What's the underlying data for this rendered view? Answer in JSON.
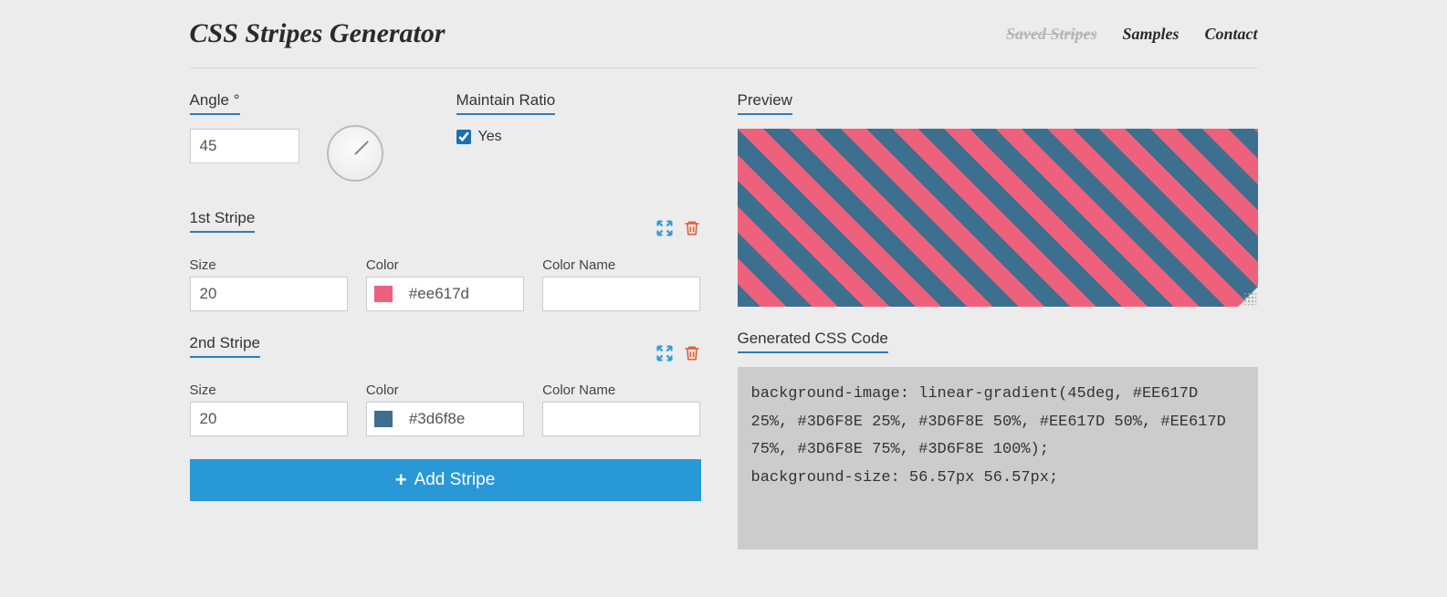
{
  "header": {
    "title": "CSS Stripes Generator",
    "nav": {
      "saved": "Saved Stripes",
      "samples": "Samples",
      "contact": "Contact"
    }
  },
  "labels": {
    "angle": "Angle °",
    "maintain_ratio": "Maintain Ratio",
    "yes": "Yes",
    "size": "Size",
    "color": "Color",
    "color_name": "Color Name",
    "preview": "Preview",
    "generated": "Generated CSS Code",
    "add_stripe": "Add Stripe"
  },
  "angle": {
    "value": "45"
  },
  "maintain_ratio": {
    "checked": true
  },
  "stripes": [
    {
      "title": "1st Stripe",
      "size": "20",
      "color_hex": "#ee617d",
      "color_swatch": "#ee617d",
      "color_name": ""
    },
    {
      "title": "2nd Stripe",
      "size": "20",
      "color_hex": "#3d6f8e",
      "color_swatch": "#3d6f8e",
      "color_name": ""
    }
  ],
  "generated_css": "background-image: linear-gradient(45deg, #EE617D 25%, #3D6F8E 25%, #3D6F8E 50%, #EE617D 50%, #EE617D 75%, #3D6F8E 75%, #3D6F8E 100%);\nbackground-size: 56.57px 56.57px;"
}
